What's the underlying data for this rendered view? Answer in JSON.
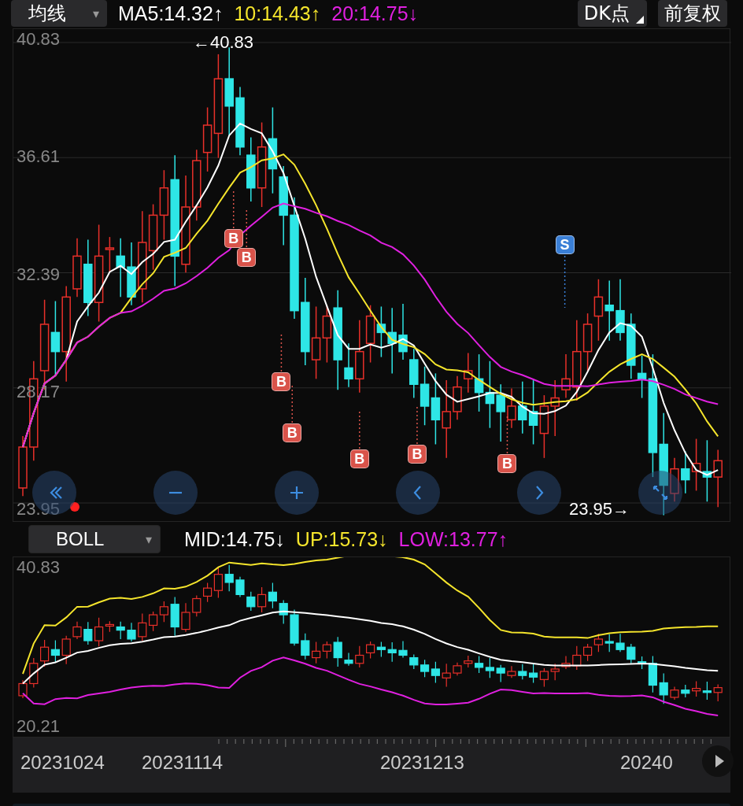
{
  "toolbar": {
    "indicator_select": {
      "label": "均线",
      "caret": "▾"
    },
    "readings": [
      {
        "text": "MA5:14.32↑",
        "color": "#ffffff"
      },
      {
        "text": "10:14.43↑",
        "color": "#f5e52c"
      },
      {
        "text": "20:14.75↓",
        "color": "#e020e0"
      }
    ],
    "dk_button": "DK点",
    "adjust_button": "前复权"
  },
  "main_chart": {
    "y_labels": [
      "40.83",
      "36.61",
      "32.39",
      "28.17",
      "23.95"
    ],
    "high_label": "←40.83",
    "low_label": "23.95→",
    "trade_marks": [
      {
        "label": "B",
        "kind": "buy"
      },
      {
        "label": "B",
        "kind": "buy"
      },
      {
        "label": "B",
        "kind": "buy"
      },
      {
        "label": "B",
        "kind": "buy"
      },
      {
        "label": "B",
        "kind": "buy"
      },
      {
        "label": "B",
        "kind": "buy"
      },
      {
        "label": "B",
        "kind": "buy"
      },
      {
        "label": "S",
        "kind": "sell"
      }
    ],
    "controls": [
      {
        "kind": "rewind"
      },
      {
        "kind": "zoom-out"
      },
      {
        "kind": "zoom-in"
      },
      {
        "kind": "prev"
      },
      {
        "kind": "next"
      },
      {
        "kind": "fit"
      }
    ]
  },
  "boll_bar": {
    "select": {
      "label": "BOLL",
      "caret": "▾"
    },
    "readings": [
      {
        "text": "MID:14.75↓",
        "color": "#ffffff"
      },
      {
        "text": "UP:15.73↓",
        "color": "#f5e52c"
      },
      {
        "text": "LOW:13.77↑",
        "color": "#e020e0"
      }
    ]
  },
  "boll_chart": {
    "y_labels": [
      "40.83",
      "20.21"
    ]
  },
  "date_axis": {
    "labels": [
      "20231024",
      "20231114",
      "20231213",
      "20240"
    ]
  }
}
